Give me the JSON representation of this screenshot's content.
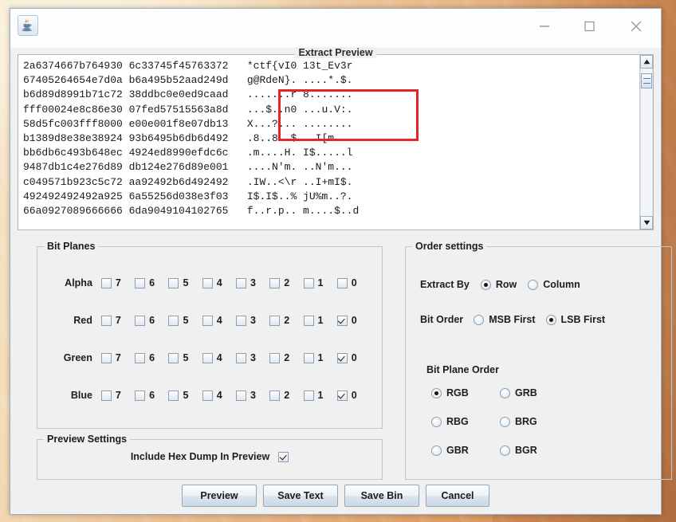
{
  "window": {
    "app_icon": "java-coffee-cup-icon",
    "controls": {
      "minimize": "minimize-icon",
      "maximize": "maximize-icon",
      "close": "close-icon"
    }
  },
  "preview": {
    "title": "Extract Preview",
    "hex_lines": [
      "2a6374667b764930 6c33745f45763372   *ctf{vI0 13t_Ev3r",
      "67405264654e7d0a b6a495b52aad249d   g@RdeN}. ....*.$.",
      "b6d89d8991b71c72 38ddbc0e0ed9caad   .......r 8.......",
      "fff00024e8c86e30 07fed57515563a8d   ...$..n0 ...u.V:.",
      "58d5fc003fff8000 e00e001f8e07db13   X...?... ........",
      "b1389d8e38e38924 93b6495b6db6d492   .8..8..$ ..I[m...",
      "bb6db6c493b648ec 4924ed8990efdc6c   .m....H. I$.....l",
      "9487db1c4e276d89 db124e276d89e001   ....N'm. ..N'm...",
      "c049571b923c5c72 aa92492b6d492492   .IW..<\\r ..I+mI$.",
      "492492492492a925 6a55256d038e3f03   I$.I$..% jU%m..?.",
      "66a0927089666666 6da9049104102765   f..r.p.. m....$..d"
    ],
    "scrollbar": {
      "up_arrow": "scroll-up-arrow-icon",
      "down_arrow": "scroll-down-arrow-icon",
      "thumb": "scrollbar-thumb"
    },
    "annotation": "red-highlight-rectangle"
  },
  "bit_planes": {
    "legend": "Bit Planes",
    "bit_labels": [
      "7",
      "6",
      "5",
      "4",
      "3",
      "2",
      "1",
      "0"
    ],
    "channels": [
      {
        "name": "Alpha",
        "checked": [
          false,
          false,
          false,
          false,
          false,
          false,
          false,
          false
        ]
      },
      {
        "name": "Red",
        "checked": [
          false,
          false,
          false,
          false,
          false,
          false,
          false,
          true
        ]
      },
      {
        "name": "Green",
        "checked": [
          false,
          false,
          false,
          false,
          false,
          false,
          false,
          true
        ]
      },
      {
        "name": "Blue",
        "checked": [
          false,
          false,
          false,
          false,
          false,
          false,
          false,
          true
        ]
      }
    ]
  },
  "preview_settings": {
    "legend": "Preview Settings",
    "include_hex_dump_label": "Include Hex Dump In Preview",
    "include_hex_dump_checked": true
  },
  "order_settings": {
    "legend": "Order settings",
    "extract_by": {
      "label": "Extract By",
      "options": [
        {
          "label": "Row",
          "selected": true
        },
        {
          "label": "Column",
          "selected": false
        }
      ]
    },
    "bit_order": {
      "label": "Bit Order",
      "options": [
        {
          "label": "MSB First",
          "selected": false
        },
        {
          "label": "LSB First",
          "selected": true
        }
      ]
    },
    "bit_plane_order": {
      "label": "Bit Plane Order",
      "options": [
        {
          "label": "RGB",
          "selected": true
        },
        {
          "label": "GRB",
          "selected": false
        },
        {
          "label": "RBG",
          "selected": false
        },
        {
          "label": "BRG",
          "selected": false
        },
        {
          "label": "GBR",
          "selected": false
        },
        {
          "label": "BGR",
          "selected": false
        }
      ]
    }
  },
  "buttons": [
    {
      "label": "Preview"
    },
    {
      "label": "Save Text"
    },
    {
      "label": "Save Bin"
    },
    {
      "label": "Cancel"
    }
  ],
  "colors": {
    "annotation_red": "#e8232a",
    "window_bg": "#f0f0f0",
    "text_area_bg": "#ffffff"
  }
}
